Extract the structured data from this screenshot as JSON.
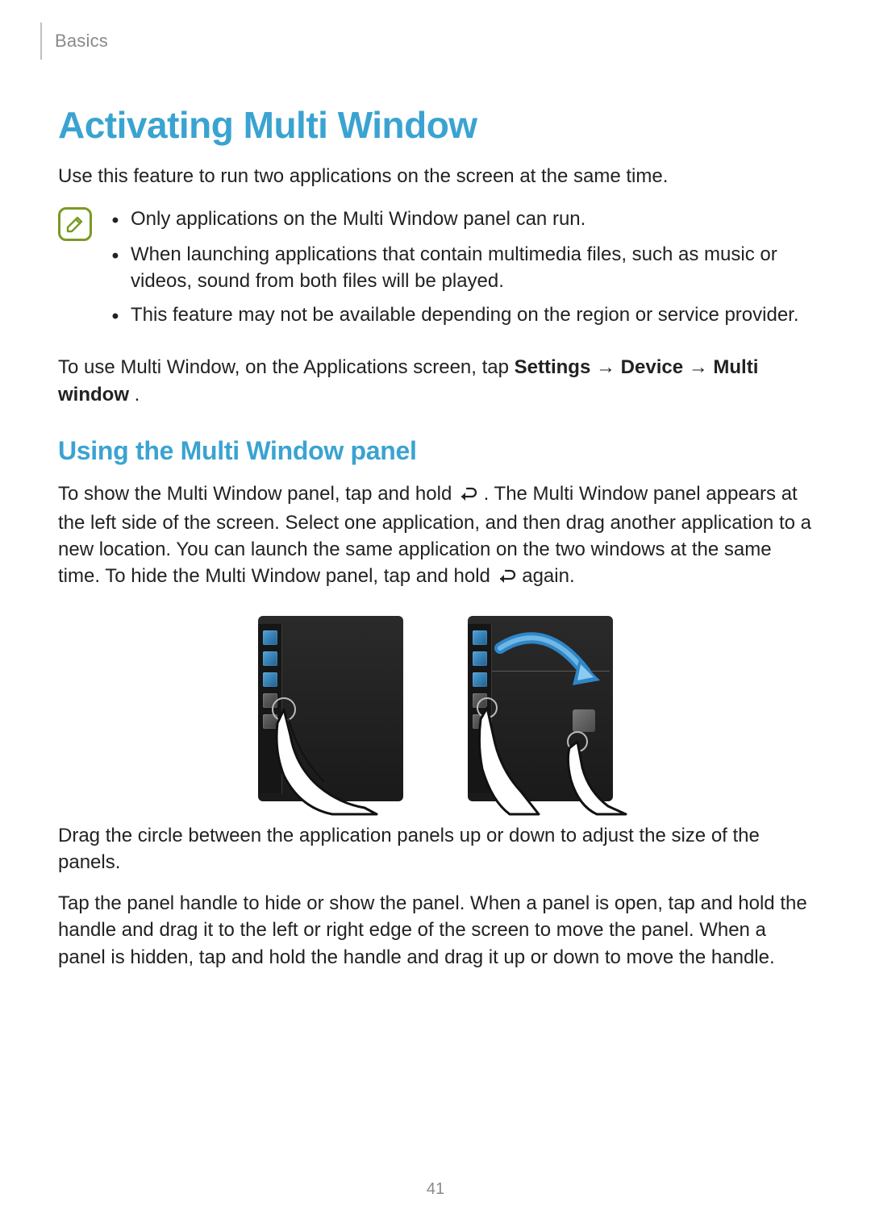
{
  "header": {
    "section": "Basics"
  },
  "title": "Activating Multi Window",
  "intro": "Use this feature to run two applications on the screen at the same time.",
  "notes": {
    "icon_name": "note-pencil-icon",
    "items": [
      "Only applications on the Multi Window panel can run.",
      "When launching applications that contain multimedia files, such as music or videos, sound from both files will be played.",
      "This feature may not be available depending on the region or service provider."
    ]
  },
  "instruction": {
    "lead": "To use Multi Window, on the Applications screen, tap ",
    "bold1": "Settings",
    "arrow": " → ",
    "bold2": "Device",
    "bold3": "Multi window",
    "full_tail": "."
  },
  "subtitle": "Using the Multi Window panel",
  "panel_para": {
    "p1a": "To show the Multi Window panel, tap and hold ",
    "p1b": ". The Multi Window panel appears at the left side of the screen. Select one application, and then drag another application to a new location. You can launch the same application on the two windows at the same time. To hide the Multi Window panel, tap and hold ",
    "p1c": " again."
  },
  "post_figure": {
    "p2": "Drag the circle between the application panels up or down to adjust the size of the panels.",
    "p3": "Tap the panel handle to hide or show the panel. When a panel is open, tap and hold the handle and drag it to the left or right edge of the screen to move the panel. When a panel is hidden, tap and hold the handle and drag it up or down to move the handle."
  },
  "page_number": "41",
  "icons": {
    "back_icon_name": "back-return-icon",
    "bullet_dot": "•"
  }
}
